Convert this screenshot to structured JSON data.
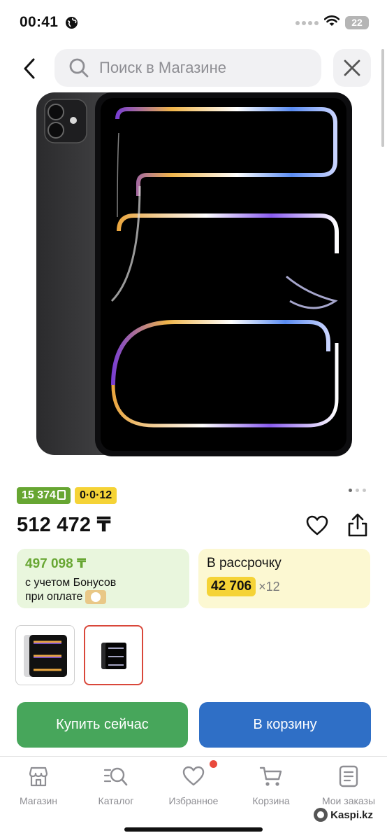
{
  "status_bar": {
    "time": "00:41",
    "battery": "22"
  },
  "search": {
    "placeholder": "Поиск в Магазине",
    "value": ""
  },
  "product": {
    "bonus_badge": "15 374",
    "installment_badge": "0·0·12",
    "price": "512 472 ₸",
    "image_count": 3,
    "image_index": 0
  },
  "bonus_card": {
    "price": "497 098 ₸",
    "line1": "с учетом Бонусов",
    "line2": "при оплате"
  },
  "installment_card": {
    "title": "В рассрочку",
    "amount": "42 706",
    "multiplier": "×12"
  },
  "actions": {
    "buy_now": "Купить сейчас",
    "add_to_cart": "В корзину"
  },
  "bottom_nav": {
    "items": [
      {
        "label": "Магазин",
        "icon": "store-icon"
      },
      {
        "label": "Каталог",
        "icon": "catalog-search-icon"
      },
      {
        "label": "Избранное",
        "icon": "heart-icon"
      },
      {
        "label": "Корзина",
        "icon": "cart-icon"
      },
      {
        "label": "Мои заказы",
        "icon": "orders-icon"
      }
    ]
  },
  "watermark": "Kaspi.kz",
  "colors": {
    "bonus_green": "#67a632",
    "installment_yellow": "#f5d336",
    "buy_green": "#47a65b",
    "cart_blue": "#2f6fc6",
    "selected_thumb_red": "#d9473a",
    "notification_dot": "#e94a3d"
  }
}
